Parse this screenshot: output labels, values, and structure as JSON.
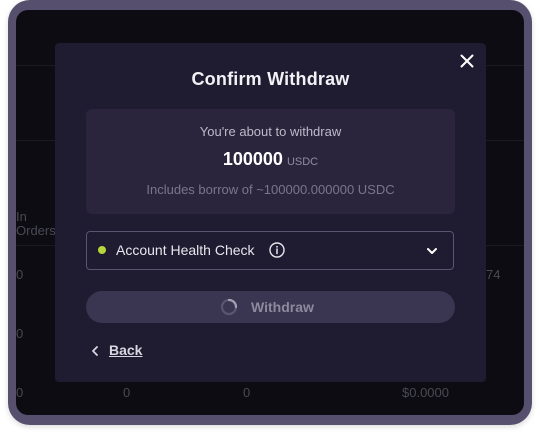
{
  "background_table": {
    "header_partial": [
      "In",
      "Orders"
    ],
    "row1": {
      "col1": "0",
      "col_right": "74"
    },
    "row2": {
      "col1": "0"
    },
    "row3": {
      "col1": "0",
      "col2": "0",
      "col3": "0",
      "col4": "$0.0000"
    }
  },
  "modal": {
    "title": "Confirm Withdraw",
    "summary": {
      "label": "You're about to withdraw",
      "amount": "100000",
      "unit": "USDC",
      "borrow_note": "Includes borrow of ~100000.000000 USDC"
    },
    "health_check": {
      "label": "Account Health Check",
      "status_color": "#b6d63c",
      "status_icon": "status-dot",
      "info_icon": "info-icon",
      "expand_icon": "chevron-down-icon"
    },
    "withdraw_button": {
      "label": "Withdraw",
      "state_icon": "spinner-icon"
    },
    "back_link": {
      "label": "Back",
      "icon": "chevron-left-icon"
    },
    "close_icon": "close-icon"
  },
  "colors": {
    "frame": "#56506e",
    "backdrop": "#0c0c12",
    "modal_bg": "#1f1b30",
    "summary_bg": "#2a253d",
    "button_bg": "#3a3550",
    "accent_green": "#b6d63c"
  }
}
